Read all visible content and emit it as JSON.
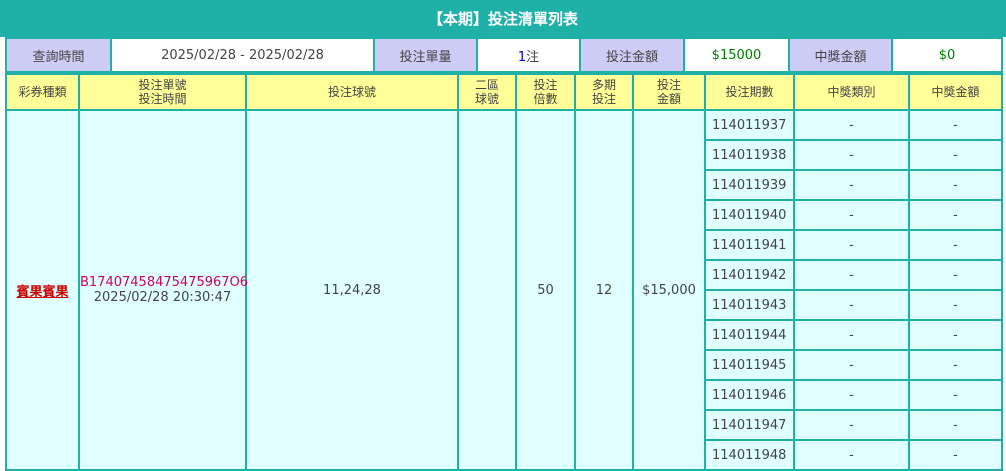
{
  "title": "【本期】投注清單列表",
  "summary": {
    "query_time_label": "查詢時間",
    "query_time_value": "2025/02/28 - 2025/02/28",
    "bet_count_label": "投注單量",
    "bet_count_num": "1",
    "bet_count_unit": "注",
    "bet_amount_label": "投注金額",
    "bet_amount_value": "$15000",
    "win_amount_label": "中獎金額",
    "win_amount_value": "$0"
  },
  "headers": {
    "lottery_type": "彩券種類",
    "ticket_no_line1": "投注單號",
    "ticket_no_line2": "投注時間",
    "numbers": "投注球號",
    "zone2_line1": "二區",
    "zone2_line2": "球號",
    "multiplier_line1": "投注",
    "multiplier_line2": "倍數",
    "multi_period_line1": "多期",
    "multi_period_line2": "投注",
    "amount_line1": "投注",
    "amount_line2": "金額",
    "issue": "投注期數",
    "prize_type": "中獎類別",
    "prize_amount": "中獎金額"
  },
  "ticket": {
    "lottery_type": "賓果賓果",
    "ticket_no": "B17407458475475967O6",
    "bet_time": "2025/02/28 20:30:47",
    "numbers": "11,24,28",
    "zone2": "",
    "multiplier": "50",
    "multi_period": "12",
    "amount": "$15,000"
  },
  "issues": [
    {
      "issue": "114011937",
      "prize_type": "-",
      "prize_amount": "-"
    },
    {
      "issue": "114011938",
      "prize_type": "-",
      "prize_amount": "-"
    },
    {
      "issue": "114011939",
      "prize_type": "-",
      "prize_amount": "-"
    },
    {
      "issue": "114011940",
      "prize_type": "-",
      "prize_amount": "-"
    },
    {
      "issue": "114011941",
      "prize_type": "-",
      "prize_amount": "-"
    },
    {
      "issue": "114011942",
      "prize_type": "-",
      "prize_amount": "-"
    },
    {
      "issue": "114011943",
      "prize_type": "-",
      "prize_amount": "-"
    },
    {
      "issue": "114011944",
      "prize_type": "-",
      "prize_amount": "-"
    },
    {
      "issue": "114011945",
      "prize_type": "-",
      "prize_amount": "-"
    },
    {
      "issue": "114011946",
      "prize_type": "-",
      "prize_amount": "-"
    },
    {
      "issue": "114011947",
      "prize_type": "-",
      "prize_amount": "-"
    },
    {
      "issue": "114011948",
      "prize_type": "-",
      "prize_amount": "-"
    }
  ],
  "colors": {
    "teal": "#1fb0a8",
    "header_yellow": "#ffff99",
    "summary_label": "#cdcdf5",
    "cell_bg": "#e0ffff",
    "money_green": "#008000",
    "ticket_pink": "#cc0066",
    "link_red": "#cc0000"
  }
}
